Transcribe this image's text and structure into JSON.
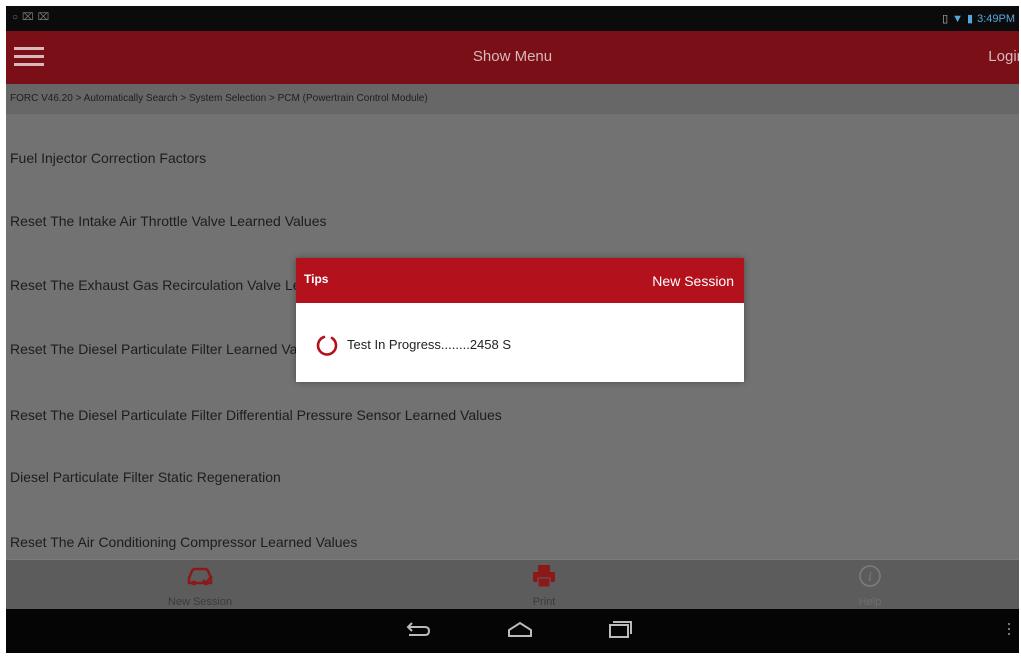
{
  "status_bar": {
    "left_icons": [
      "signal-icon",
      "usb-icon",
      "debug-icon"
    ],
    "right_icons": [
      "sim-icon",
      "wifi-icon",
      "battery-icon"
    ],
    "time": "3:49PM"
  },
  "top_bar": {
    "menu_title": "Show Menu",
    "login_label": "Login"
  },
  "breadcrumb": "FORC V46.20 > Automatically Search > System Selection > PCM (Powertrain Control Module)",
  "menu_items": [
    "Fuel Injector Correction Factors",
    "Reset The Intake Air Throttle Valve Learned Values",
    "Reset The Exhaust Gas Recirculation Valve Learned Values",
    "Reset The Diesel Particulate Filter Learned Values",
    "Reset The Diesel Particulate Filter Differential Pressure Sensor Learned Values",
    "Diesel Particulate Filter Static Regeneration",
    "Reset The Air Conditioning Compressor Learned Values"
  ],
  "bottom_bar": {
    "new_session": "New Session",
    "print": "Print",
    "help": "Help"
  },
  "dialog": {
    "title": "Tips",
    "action": "New Session",
    "message": "Test In Progress........2458 S"
  },
  "colors": {
    "header_red": "#7a0f17",
    "dialog_red": "#b3121d",
    "overlay_gray": "#727272"
  }
}
